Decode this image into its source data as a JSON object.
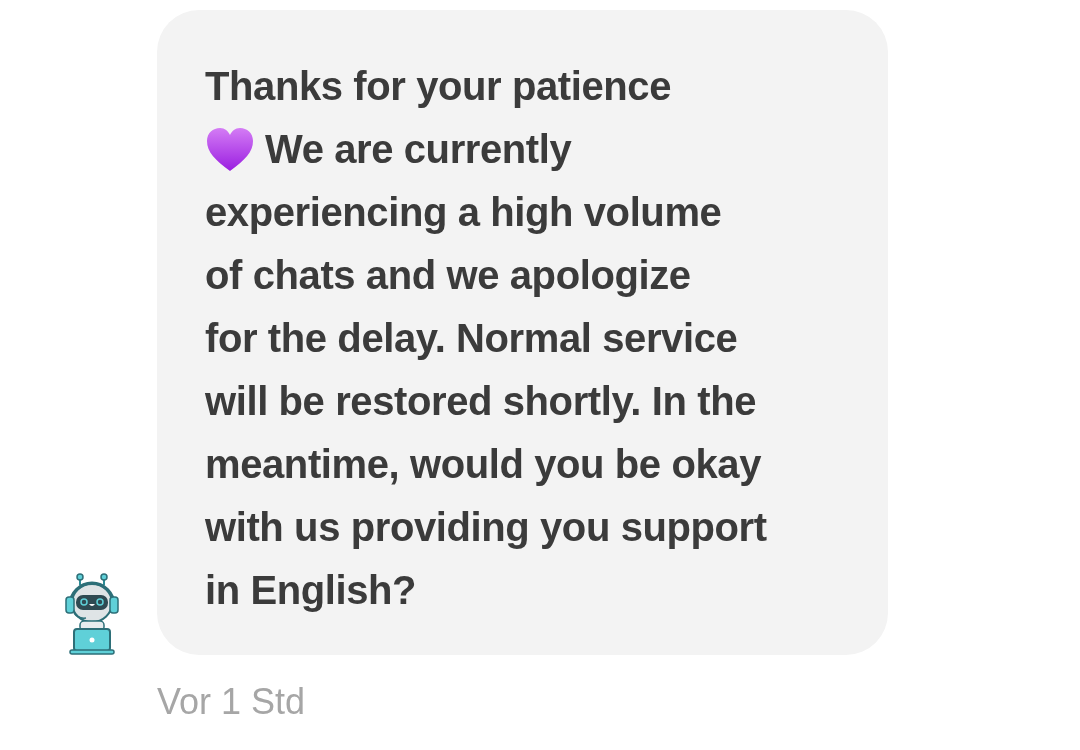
{
  "message": {
    "lines": [
      {
        "kind": "plain",
        "text": "Thanks for your patience"
      },
      {
        "kind": "heart",
        "text": "We are currently"
      },
      {
        "kind": "plain",
        "text": "experiencing a high volume"
      },
      {
        "kind": "plain",
        "text": "of chats and we apologize"
      },
      {
        "kind": "plain",
        "text": "for the delay. Normal service"
      },
      {
        "kind": "plain",
        "text": "will be restored shortly. In the"
      },
      {
        "kind": "plain",
        "text": "meantime, would you be okay"
      },
      {
        "kind": "plain",
        "text": "with us providing you support"
      },
      {
        "kind": "plain",
        "text": "in English?"
      }
    ]
  },
  "timestamp": "Vor 1 Std"
}
